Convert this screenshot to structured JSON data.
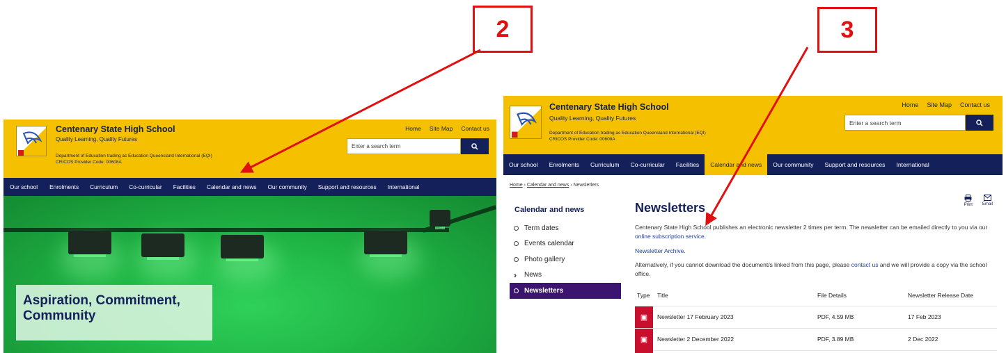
{
  "callouts": {
    "left": "2",
    "right": "3"
  },
  "school": {
    "name": "Centenary State High School",
    "tagline": "Quality Learning, Quality Futures",
    "dept": "Department of Education trading as Education Queensland International (EQI)",
    "cricos": "CRICOS Provider Code: 00608A"
  },
  "top_links": [
    "Home",
    "Site Map",
    "Contact us"
  ],
  "search": {
    "placeholder": "Enter a search term",
    "button_icon": "search-icon"
  },
  "nav": [
    "Our school",
    "Enrolments",
    "Curriculum",
    "Co-curricular",
    "Facilities",
    "Calendar and news",
    "Our community",
    "Support and resources",
    "International"
  ],
  "hero": {
    "line1": "Aspiration, Commitment,",
    "line2": "Community"
  },
  "breadcrumb": {
    "home": "Home",
    "section": "Calendar and news",
    "current": "Newsletters"
  },
  "sidebar": {
    "title": "Calendar and news",
    "items": [
      "Term dates",
      "Events calendar",
      "Photo gallery",
      "News",
      "Newsletters"
    ]
  },
  "page": {
    "title": "Newsletters",
    "print": "Print",
    "email": "Email",
    "intro_a": "Centenary State High School publishes an electronic newsletter 2 times per term.  The newsletter can be emailed directly to you via our ",
    "intro_link": "online subscription service",
    "intro_b": ".",
    "archive": "Newsletter Archive.",
    "alt_a": "Alternatively, if you cannot download the document/s linked from this page, please ",
    "alt_link": "contact us",
    "alt_b": " and we will provide a copy via the school office."
  },
  "table": {
    "headers": [
      "Type",
      "Title",
      "File Details",
      "Newsletter Release Date"
    ],
    "rows": [
      {
        "title": "Newsletter 17 February 2023",
        "details": "PDF, 4.59 MB",
        "date": "17 Feb 2023"
      },
      {
        "title": "Newsletter 2 December 2022",
        "details": "PDF, 3.89 MB",
        "date": "2 Dec 2022"
      }
    ]
  },
  "colors": {
    "gold": "#f5c000",
    "navy": "#14205a",
    "active_side": "#3b1470",
    "callout": "#e01010",
    "pdf": "#c8102e"
  }
}
